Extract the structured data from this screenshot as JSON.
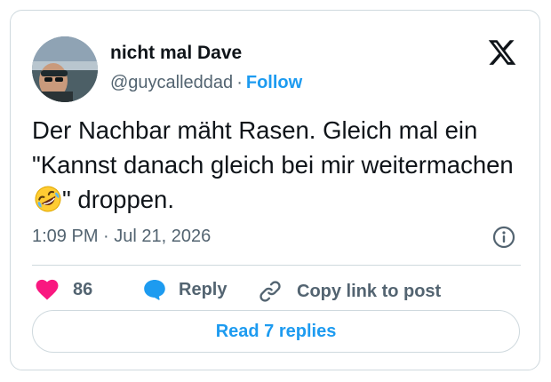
{
  "author": {
    "name": "nicht mal Dave",
    "handle": "@guycalleddad",
    "separator": "·",
    "follow_label": "Follow"
  },
  "tweet": {
    "text_before_emoji": "Der Nachbar mäht Rasen. Gleich mal ein \"Kannst danach gleich bei mir weitermachen",
    "emoji": "rolling-on-the-floor-laughing",
    "text_after_emoji": "\" droppen.",
    "time": "1:09 PM",
    "separator": "·",
    "date": "Jul 21, 2026"
  },
  "actions": {
    "like_count": "86",
    "reply_label": "Reply",
    "copy_label": "Copy link to post"
  },
  "read_replies_label": "Read 7 replies",
  "colors": {
    "accent": "#1d9bf0",
    "like": "#f91880",
    "text": "#0f1419",
    "muted": "#536471",
    "border": "#cfd9de"
  },
  "icons": [
    "x-logo-icon",
    "info-icon",
    "heart-icon",
    "reply-bubble-icon",
    "link-icon"
  ]
}
